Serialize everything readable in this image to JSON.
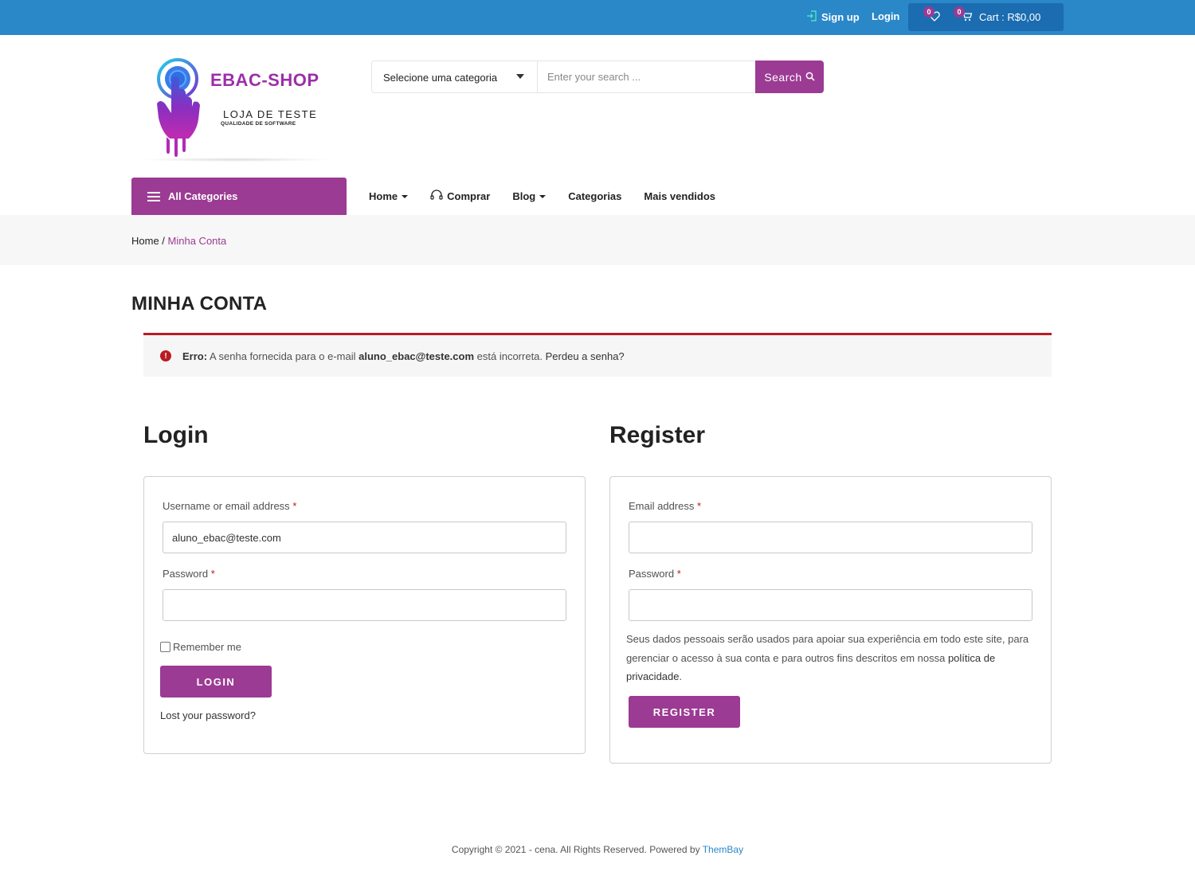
{
  "topbar": {
    "signup": "Sign up",
    "login": "Login",
    "wishlist_count": "0",
    "cart_count": "0",
    "cart_label": "Cart : R$0,00"
  },
  "logo": {
    "brand": "EBAC-SHOP",
    "tagline": "LOJA DE TESTE",
    "subtagline": "QUALIDADE DE SOFTWARE"
  },
  "search": {
    "category": "Selecione uma categoria",
    "placeholder": "Enter your search ...",
    "button": "Search"
  },
  "nav": {
    "all_categories": "All Categories",
    "items": [
      "Home",
      "Comprar",
      "Blog",
      "Categorias",
      "Mais vendidos"
    ]
  },
  "breadcrumb": {
    "home": "Home",
    "separator": " / ",
    "current": "Minha Conta"
  },
  "page_title": "MINHA CONTA",
  "error": {
    "prefix": "Erro:",
    "text_before": " A senha fornecida para o e-mail ",
    "email": "aluno_ebac@teste.com",
    "text_after": " está incorreta. ",
    "link": "Perdeu a senha?"
  },
  "login": {
    "title": "Login",
    "username_label": "Username or email address",
    "username_value": "aluno_ebac@teste.com",
    "password_label": "Password",
    "required_mark": "*",
    "remember": "Remember me",
    "button": "LOGIN",
    "lost_password": "Lost your password?"
  },
  "register": {
    "title": "Register",
    "email_label": "Email address",
    "password_label": "Password",
    "privacy_text": "Seus dados pessoais serão usados para apoiar sua experiência em todo este site, para gerenciar o acesso à sua conta e para outros fins descritos em nossa ",
    "privacy_link": "política de privacidade",
    "privacy_end": ".",
    "button": "REGISTER"
  },
  "footer": {
    "text": "Copyright © 2021 - cena. All Rights Reserved. Powered by ",
    "link": "ThemBay"
  },
  "colors": {
    "topbar": "#2a87c8",
    "accent": "#9b3b93",
    "error": "#b81c23"
  }
}
